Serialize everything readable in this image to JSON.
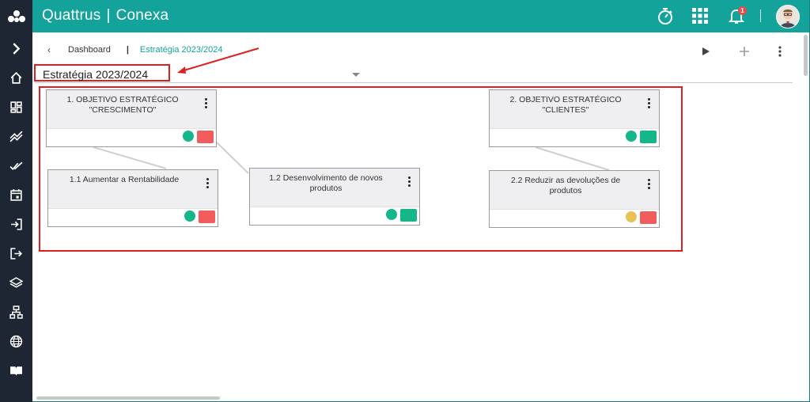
{
  "header": {
    "brand_left": "Quattrus",
    "brand_separator": "|",
    "brand_right": "Conexa",
    "notification_count": "1",
    "icons": [
      "stopwatch-icon",
      "apps-grid-icon",
      "bell-icon",
      "avatar"
    ]
  },
  "sidebar": {
    "items": [
      "expand-chevron-icon",
      "home-icon",
      "dashboard-icon",
      "trend-icon",
      "double-check-icon",
      "calendar-icon",
      "import-icon",
      "export-icon",
      "layers-icon",
      "hierarchy-icon",
      "globe-icon",
      "book-icon"
    ]
  },
  "breadcrumb": {
    "back": "‹",
    "dashboard": "Dashboard",
    "separator": "|",
    "current": "Estratégia 2023/2024"
  },
  "toolbar": {
    "icons": [
      "play-icon",
      "add-icon",
      "more-vertical-icon"
    ]
  },
  "strategy_select": {
    "value": "Estratégia 2023/2024"
  },
  "cards": [
    {
      "title": "1. OBJETIVO ESTRATÉGICO \"CRESCIMENTO\"",
      "status_color": "#14b78a",
      "bar_color": "#f25c5c"
    },
    {
      "title": "1.1 Aumentar a Rentabilidade",
      "status_color": "#14b78a",
      "bar_color": "#f25c5c"
    },
    {
      "title": "1.2 Desenvolvimento de novos produtos",
      "status_color": "#14b78a",
      "bar_color": "#14b78a"
    },
    {
      "title": "2. OBJETIVO ESTRATÉGICO \"CLIENTES\"",
      "status_color": "#14b78a",
      "bar_color": "#14b78a"
    },
    {
      "title": "2.2 Reduzir as devoluções de produtos",
      "status_color": "#e8c254",
      "bar_color": "#f25c5c"
    }
  ],
  "colors": {
    "brand": "#14a39a",
    "sidebar": "#1f2633",
    "highlight": "#e02020"
  }
}
